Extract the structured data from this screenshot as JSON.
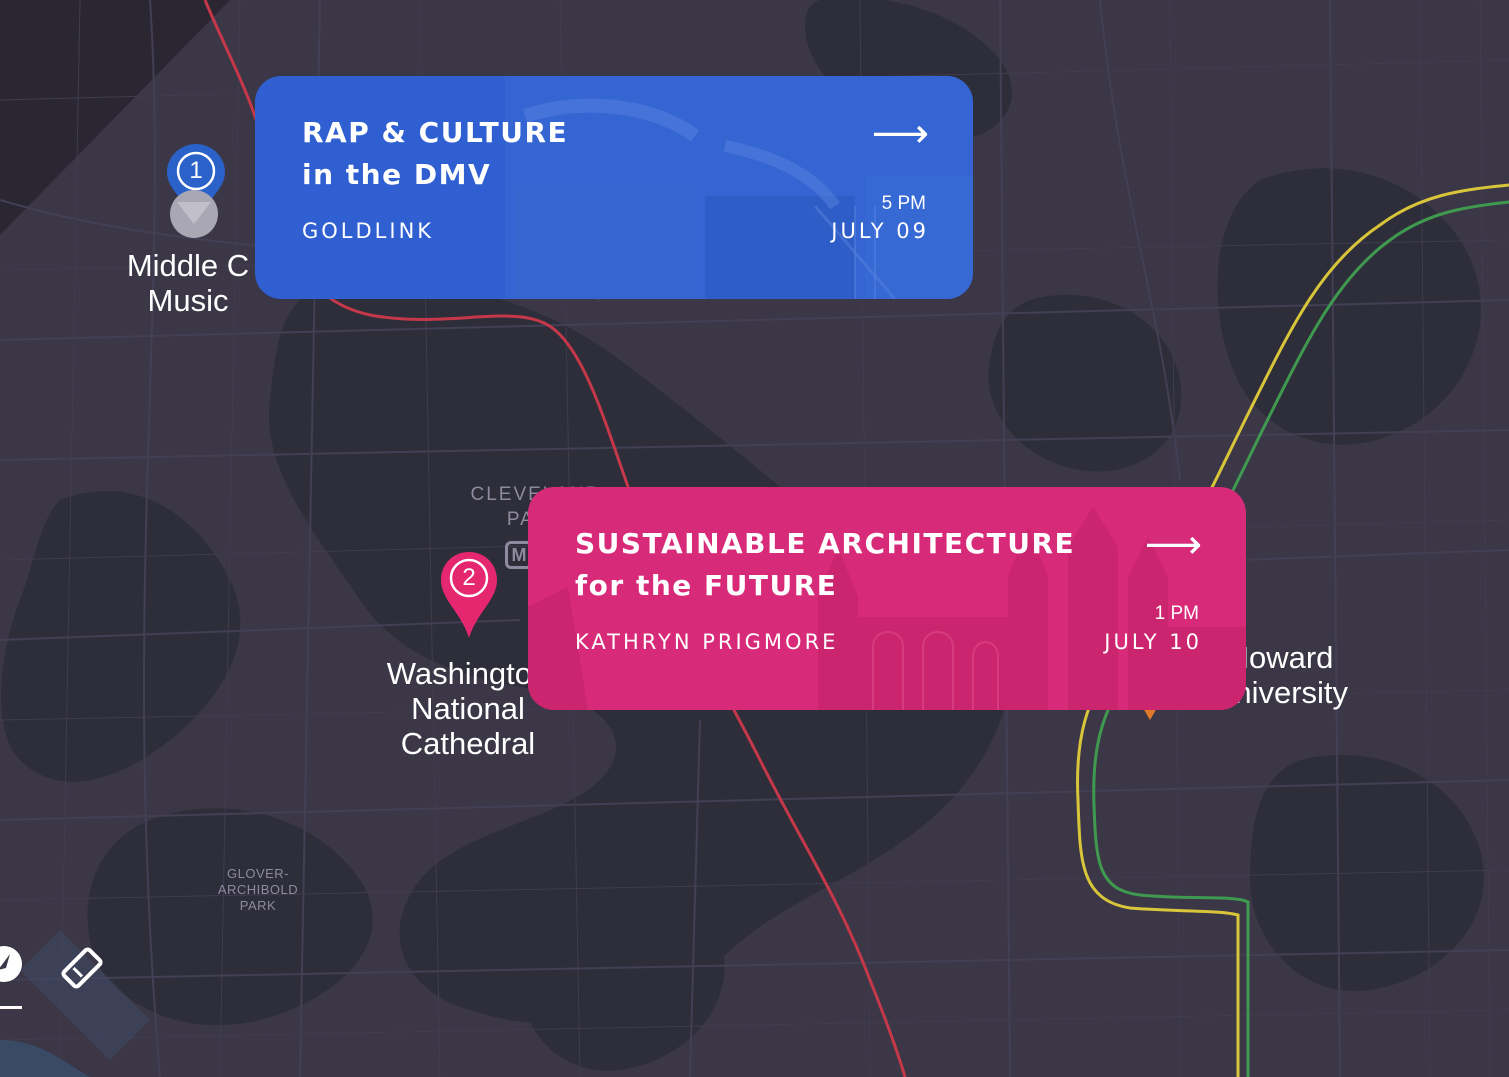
{
  "colors": {
    "map_bg": "#3b3747",
    "park": "#2c2d38",
    "road": "#46425a",
    "red_line": "#c4384a",
    "yellow_line": "#d9c53a",
    "green_line": "#3f9a4f",
    "card1_bg": "#2f5fd0",
    "card2_bg": "#d72a78",
    "pin1": "#2a62c9",
    "pin2": "#e5276f"
  },
  "events": [
    {
      "number": "1",
      "title_line1": "RAP & CULTURE",
      "title_line2": "in the DMV",
      "presenter": "GOLDLINK",
      "time": "5 PM",
      "date": "JULY 09",
      "arrow": "⟶",
      "pin_icon": "map-pin-icon"
    },
    {
      "number": "2",
      "title_line1": "SUSTAINABLE ARCHITECTURE",
      "title_line2": "for the FUTURE",
      "presenter": "KATHRYN PRIGMORE",
      "time": "1 PM",
      "date": "JULY 10",
      "arrow": "⟶",
      "pin_icon": "map-pin-icon"
    }
  ],
  "places": {
    "middle_c_line1": "Middle C",
    "middle_c_line2": "Music",
    "cathedral_line1": "Washington",
    "cathedral_line2": "National",
    "cathedral_line3": "Cathedral",
    "howard_line1": "Howard",
    "howard_line2": "University",
    "cleveland_line1": "CLEVELAND",
    "cleveland_line2": "PARK",
    "glover_line1": "GLOVER-",
    "glover_line2": "ARCHIBOLD",
    "glover_line3": "PARK",
    "metro_badge": "M"
  },
  "toolbar": {
    "compass_icon": "compass-icon",
    "ticket_icon": "ticket-icon"
  }
}
